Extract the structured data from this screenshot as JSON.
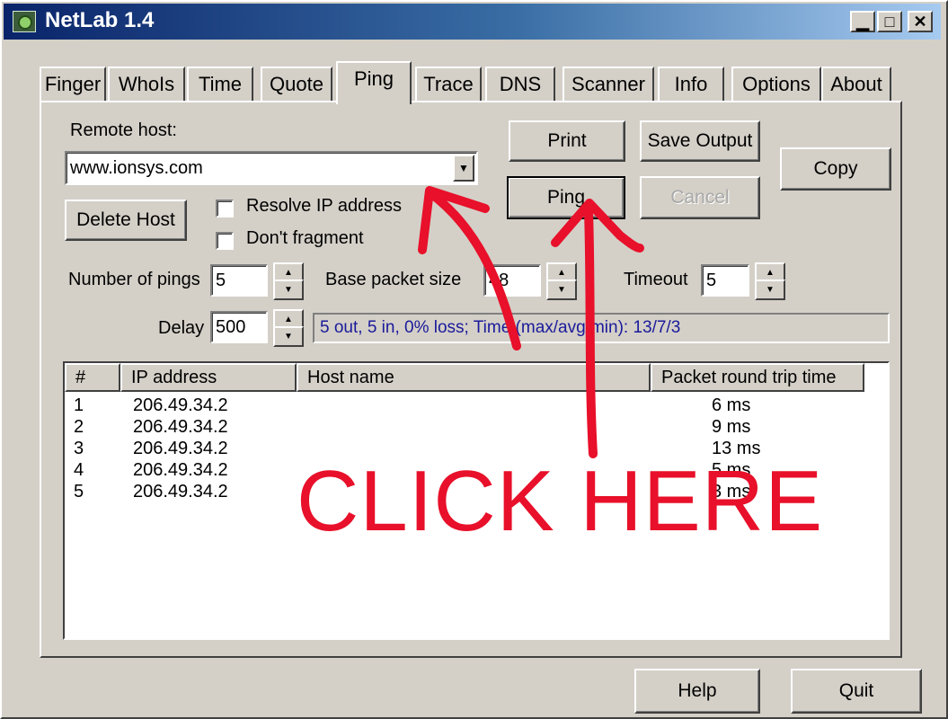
{
  "window": {
    "title": "NetLab 1.4"
  },
  "title_buttons": {
    "minimize": "▁",
    "maximize": "□",
    "close": "✕"
  },
  "tabs": [
    {
      "label": "Finger"
    },
    {
      "label": "WhoIs"
    },
    {
      "label": "Time"
    },
    {
      "label": "Quote"
    },
    {
      "label": "Ping"
    },
    {
      "label": "Trace"
    },
    {
      "label": "DNS"
    },
    {
      "label": "Scanner"
    },
    {
      "label": "Info"
    },
    {
      "label": "Options"
    },
    {
      "label": "About"
    }
  ],
  "active_tab": "Ping",
  "ping": {
    "remote_host_label": "Remote host:",
    "remote_host_value": "www.ionsys.com",
    "delete_host_button": "Delete Host",
    "resolve_ip_label": "Resolve IP address",
    "resolve_ip_checked": false,
    "dont_fragment_label": "Don't fragment",
    "dont_fragment_checked": false,
    "print_button": "Print",
    "save_output_button": "Save Output",
    "copy_button": "Copy",
    "ping_button": "Ping",
    "cancel_button": "Cancel",
    "num_pings_label": "Number of pings",
    "num_pings_value": "5",
    "base_packet_label": "Base packet size",
    "base_packet_value": "48",
    "timeout_label": "Timeout",
    "timeout_value": "5",
    "delay_label": "Delay",
    "delay_value": "500",
    "status_text": "5 out, 5 in, 0% loss; Time (max/avg/min): 13/7/3"
  },
  "results": {
    "columns": [
      "#",
      "IP address",
      "Host name",
      "Packet round trip time"
    ],
    "rows": [
      {
        "n": "1",
        "ip": "206.49.34.2",
        "host": "",
        "rtt": "6 ms"
      },
      {
        "n": "2",
        "ip": "206.49.34.2",
        "host": "",
        "rtt": "9 ms"
      },
      {
        "n": "3",
        "ip": "206.49.34.2",
        "host": "",
        "rtt": "13 ms"
      },
      {
        "n": "4",
        "ip": "206.49.34.2",
        "host": "",
        "rtt": "5 ms"
      },
      {
        "n": "5",
        "ip": "206.49.34.2",
        "host": "",
        "rtt": "3 ms"
      }
    ]
  },
  "footer": {
    "help_button": "Help",
    "quit_button": "Quit"
  },
  "annotation": {
    "text": "CLICK HERE",
    "color": "#e8102a"
  }
}
